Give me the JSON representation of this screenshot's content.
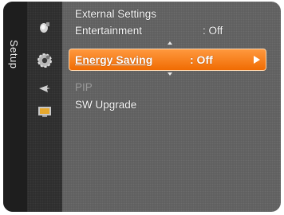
{
  "tab": {
    "label": "Setup"
  },
  "menu": {
    "items": [
      {
        "label": "External Settings",
        "value": ""
      },
      {
        "label": "Entertainment",
        "value": ": Off"
      },
      {
        "label": "Energy Saving",
        "value": ": Off",
        "selected": true
      },
      {
        "label": "PIP",
        "value": "",
        "disabled": true
      },
      {
        "label": "SW Upgrade",
        "value": ""
      }
    ]
  },
  "icons": [
    "picture-icon",
    "setup-gear-icon",
    "input-icon",
    "support-icon"
  ],
  "colors": {
    "highlight": "#ff7a1c",
    "panel": "#5e5e5e",
    "tab": "#1e1e1e"
  }
}
